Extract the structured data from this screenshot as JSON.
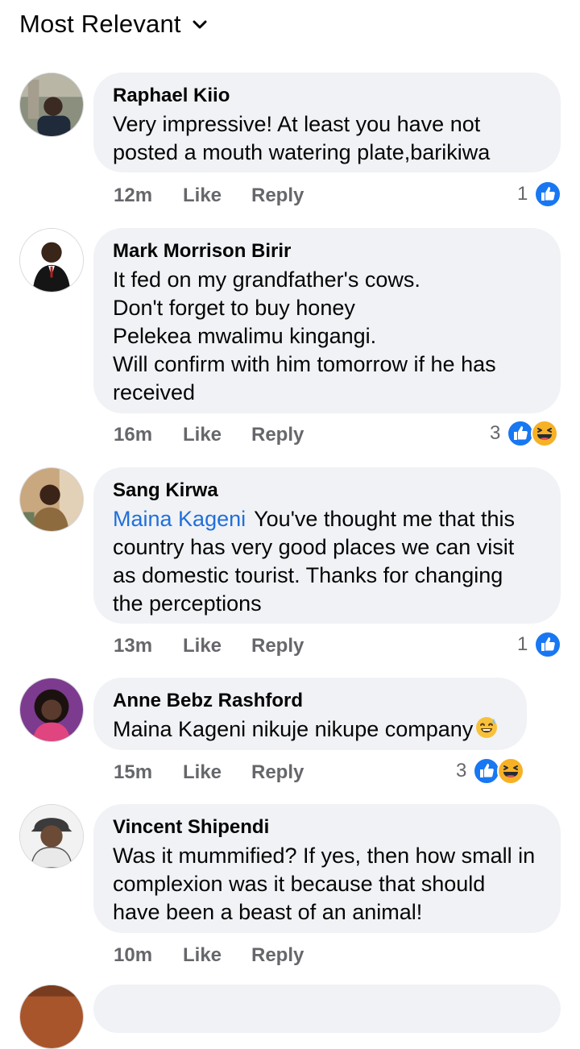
{
  "sort": {
    "label": "Most Relevant",
    "icon": "chevron-down-icon"
  },
  "comments": [
    {
      "author": "Raphael Kiio",
      "text": "Very impressive! At least you have not\nposted a mouth watering plate,barikiwa",
      "time": "12m",
      "like": "Like",
      "reply": "Reply",
      "reaction_count": "1",
      "reactions": [
        "like-reaction-icon"
      ]
    },
    {
      "author": "Mark Morrison Birir",
      "text": "It fed on my grandfather's cows.\nDon't forget to buy honey\nPelekea mwalimu kingangi.\nWill confirm with him tomorrow if he has\nreceived",
      "time": "16m",
      "like": "Like",
      "reply": "Reply",
      "reaction_count": "3",
      "reactions": [
        "like-reaction-icon",
        "haha-reaction-icon"
      ]
    },
    {
      "author": "Sang Kirwa",
      "mention": "Maina Kageni",
      "text": "You've thought me that this\ncountry has very good places we can visit\nas domestic tourist. Thanks for changing\nthe perceptions",
      "time": "13m",
      "like": "Like",
      "reply": "Reply",
      "reaction_count": "1",
      "reactions": [
        "like-reaction-icon"
      ]
    },
    {
      "author": "Anne Bebz Rashford",
      "text": "Maina Kageni nikuje nikupe company",
      "emoji": "sweat-smile-emoji",
      "time": "15m",
      "like": "Like",
      "reply": "Reply",
      "reaction_count": "3",
      "reactions": [
        "like-reaction-icon",
        "haha-reaction-icon"
      ]
    },
    {
      "author": "Vincent Shipendi",
      "text": "Was it mummified? If yes, then how small in\ncomplexion was it because that should\nhave been a beast of an animal!",
      "time": "10m",
      "like": "Like",
      "reply": "Reply"
    }
  ],
  "colors": {
    "bubble": "#f0f2f5",
    "secondary_text": "#65676b",
    "mention": "#216fdb",
    "like_blue": "#1877f2",
    "haha_yellow": "#f7b125"
  }
}
